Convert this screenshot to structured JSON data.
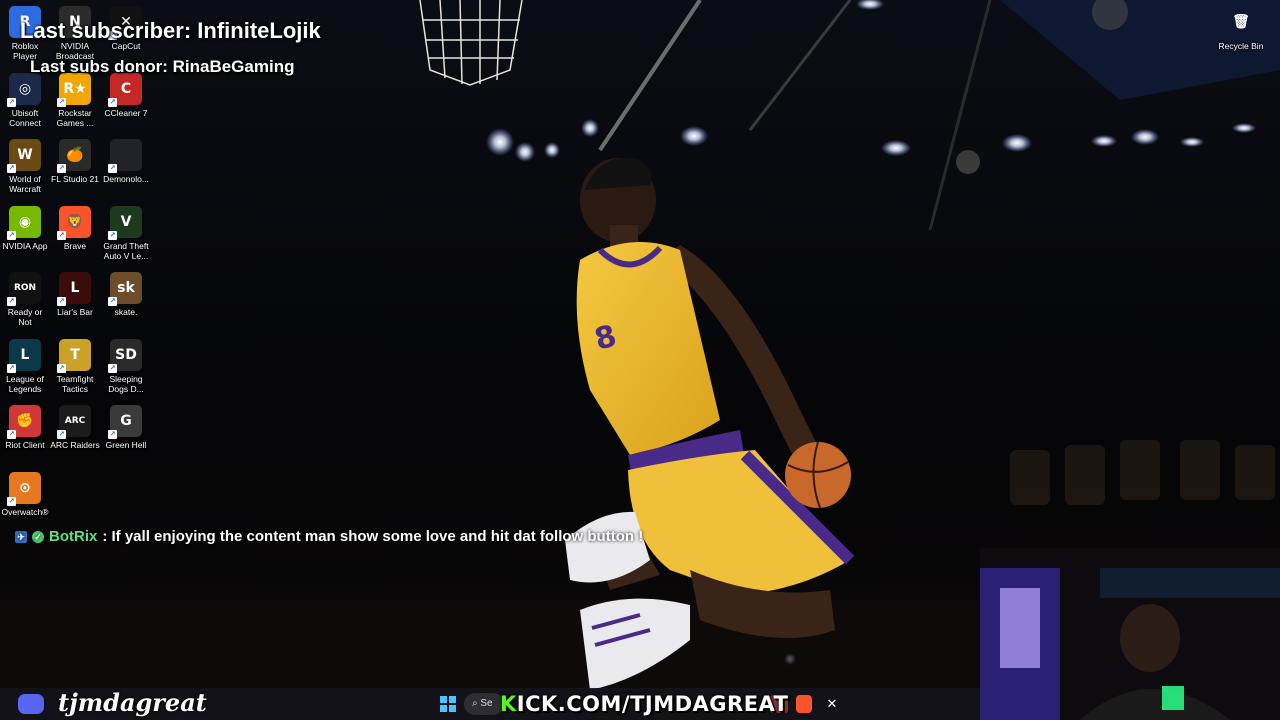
{
  "overlay": {
    "last_subscriber": "Last subscriber: InfiniteLojik",
    "last_subs_donor": "Last subs donor: RinaBeGaming"
  },
  "chat": {
    "username": "BotRix",
    "message": ": If yall enjoying the content man show some love and hit dat follow button !"
  },
  "stream": {
    "handle": "tjmdagreat",
    "url_prefix": "K",
    "url": "ICK.COM/TJMDAGREAT",
    "search_fragment": "Se"
  },
  "desktop_icons": [
    {
      "label": "Roblox Player",
      "glyph": "R",
      "color": "#2f6be0",
      "icon": "roblox-icon"
    },
    {
      "label": "NVIDIA Broadcast",
      "glyph": "N",
      "color": "#2b2b2b",
      "icon": "nvidia-broadcast-icon"
    },
    {
      "label": "CapCut",
      "glyph": "✕",
      "color": "#111111",
      "icon": "capcut-icon"
    },
    {
      "label": "Ubisoft Connect",
      "glyph": "◎",
      "color": "#1c2a4a",
      "icon": "ubisoft-icon"
    },
    {
      "label": "Rockstar Games ...",
      "glyph": "R★",
      "color": "#f2a700",
      "icon": "rockstar-icon"
    },
    {
      "label": "CCleaner 7",
      "glyph": "C",
      "color": "#c62828",
      "icon": "ccleaner-icon"
    },
    {
      "label": "World of Warcraft",
      "glyph": "W",
      "color": "#6a4a12",
      "icon": "wow-icon"
    },
    {
      "label": "FL Studio 21",
      "glyph": "🍊",
      "color": "#2a2a2a",
      "icon": "fl-studio-icon"
    },
    {
      "label": "Demonolo...",
      "glyph": "",
      "color": "#202428",
      "icon": "demonologist-icon"
    },
    {
      "label": "NVIDIA App",
      "glyph": "◉",
      "color": "#76b900",
      "icon": "nvidia-app-icon"
    },
    {
      "label": "Brave",
      "glyph": "🦁",
      "color": "#fb542b",
      "icon": "brave-icon"
    },
    {
      "label": "Grand Theft Auto V Le...",
      "glyph": "V",
      "color": "#1e3a1e",
      "icon": "gta-icon"
    },
    {
      "label": "Ready or Not",
      "glyph": "RON",
      "color": "#111111",
      "icon": "ready-or-not-icon"
    },
    {
      "label": "Liar's Bar",
      "glyph": "L",
      "color": "#3a0c0c",
      "icon": "liars-bar-icon"
    },
    {
      "label": "skate.",
      "glyph": "sk",
      "color": "#6b4d2a",
      "icon": "skate-icon"
    },
    {
      "label": "League of Legends",
      "glyph": "L",
      "color": "#0a3a4a",
      "icon": "league-icon"
    },
    {
      "label": "Teamfight Tactics",
      "glyph": "T",
      "color": "#c9a227",
      "icon": "tft-icon"
    },
    {
      "label": "Sleeping Dogs D...",
      "glyph": "SD",
      "color": "#2a2a2a",
      "icon": "sleeping-dogs-icon"
    },
    {
      "label": "Riot Client",
      "glyph": "✊",
      "color": "#d13639",
      "icon": "riot-client-icon"
    },
    {
      "label": "ARC Raiders",
      "glyph": "ARC",
      "color": "#1b1b1b",
      "icon": "arc-raiders-icon"
    },
    {
      "label": "Green Hell",
      "glyph": "G",
      "color": "#3a3a3a",
      "icon": "green-hell-icon"
    },
    {
      "label": "Overwatch®",
      "glyph": "⊙",
      "color": "#e87722",
      "icon": "overwatch-icon"
    },
    {
      "label": "Recycle Bin",
      "glyph": "🗑",
      "color": "transparent",
      "icon": "recycle-bin-icon"
    }
  ]
}
